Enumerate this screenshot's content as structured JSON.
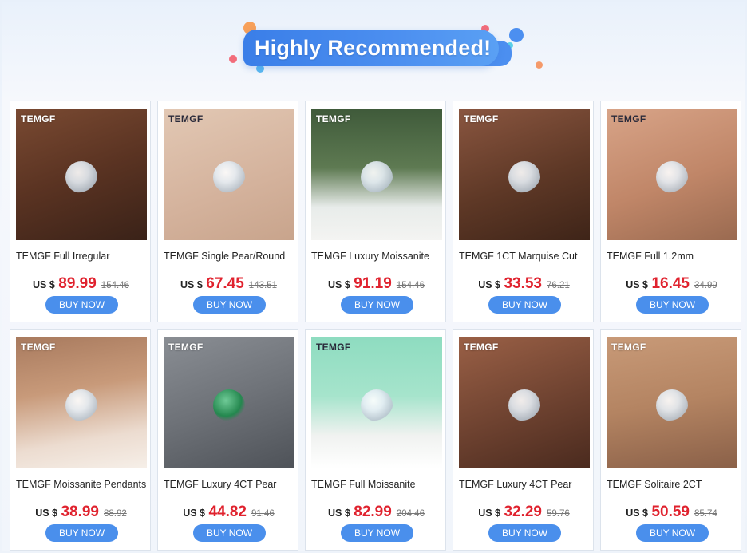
{
  "banner": {
    "title": "Highly Recommended!"
  },
  "currency_prefix": "US $",
  "buy_label": "BUY NOW",
  "brand": "TEMGF",
  "colors": {
    "accent": "#4a8fec",
    "price": "#e0222e"
  },
  "products": [
    {
      "title": "TEMGF Full Irregular",
      "price": "89.99",
      "original": "154.46"
    },
    {
      "title": "TEMGF Single Pear/Round",
      "price": "67.45",
      "original": "143.51"
    },
    {
      "title": "TEMGF Luxury Moissanite",
      "price": "91.19",
      "original": "154.46"
    },
    {
      "title": "TEMGF 1CT Marquise Cut",
      "price": "33.53",
      "original": "76.21"
    },
    {
      "title": "TEMGF Full 1.2mm",
      "price": "16.45",
      "original": "34.99"
    },
    {
      "title": "TEMGF Moissanite Pendants",
      "price": "38.99",
      "original": "88.92"
    },
    {
      "title": "TEMGF Luxury 4CT Pear",
      "price": "44.82",
      "original": "91.46"
    },
    {
      "title": "TEMGF Full Moissanite",
      "price": "82.99",
      "original": "204.46"
    },
    {
      "title": "TEMGF Luxury 4CT Pear",
      "price": "32.29",
      "original": "59.76"
    },
    {
      "title": "TEMGF Solitaire 2CT",
      "price": "50.59",
      "original": "85.74"
    }
  ]
}
